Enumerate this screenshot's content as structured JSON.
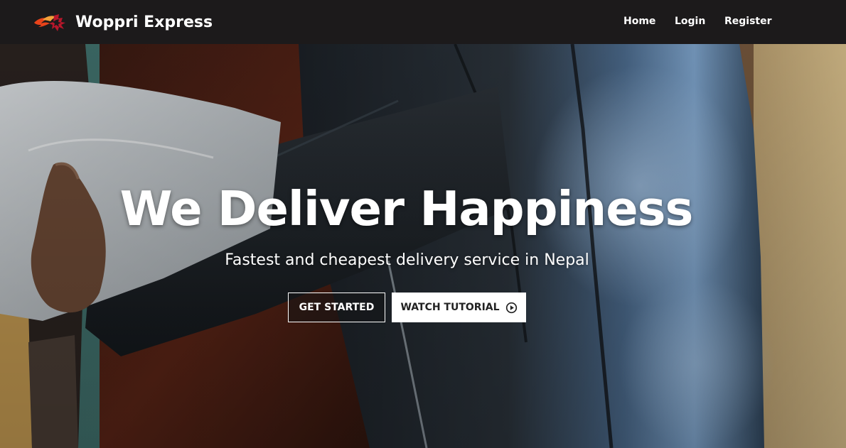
{
  "brand": {
    "name": "Woppri Express",
    "logo_icon": "flame-bird-logo",
    "logo_colors": [
      "#e8431a",
      "#b8172b",
      "#f2a13a"
    ]
  },
  "nav": {
    "items": [
      {
        "label": "Home"
      },
      {
        "label": "Login"
      },
      {
        "label": "Register"
      }
    ]
  },
  "hero": {
    "title": "We Deliver Happiness",
    "subtitle": "Fastest and cheapest delivery service in Nepal",
    "primary_button": "GET STARTED",
    "secondary_button": "WATCH TUTORIAL",
    "secondary_button_icon": "play-circle-icon",
    "background_image": "courier in leather jacket handing over package"
  },
  "colors": {
    "navbar_bg": "#1c1a1b",
    "text": "#ffffff",
    "button_light_bg": "#ffffff",
    "button_light_text": "#222222"
  }
}
